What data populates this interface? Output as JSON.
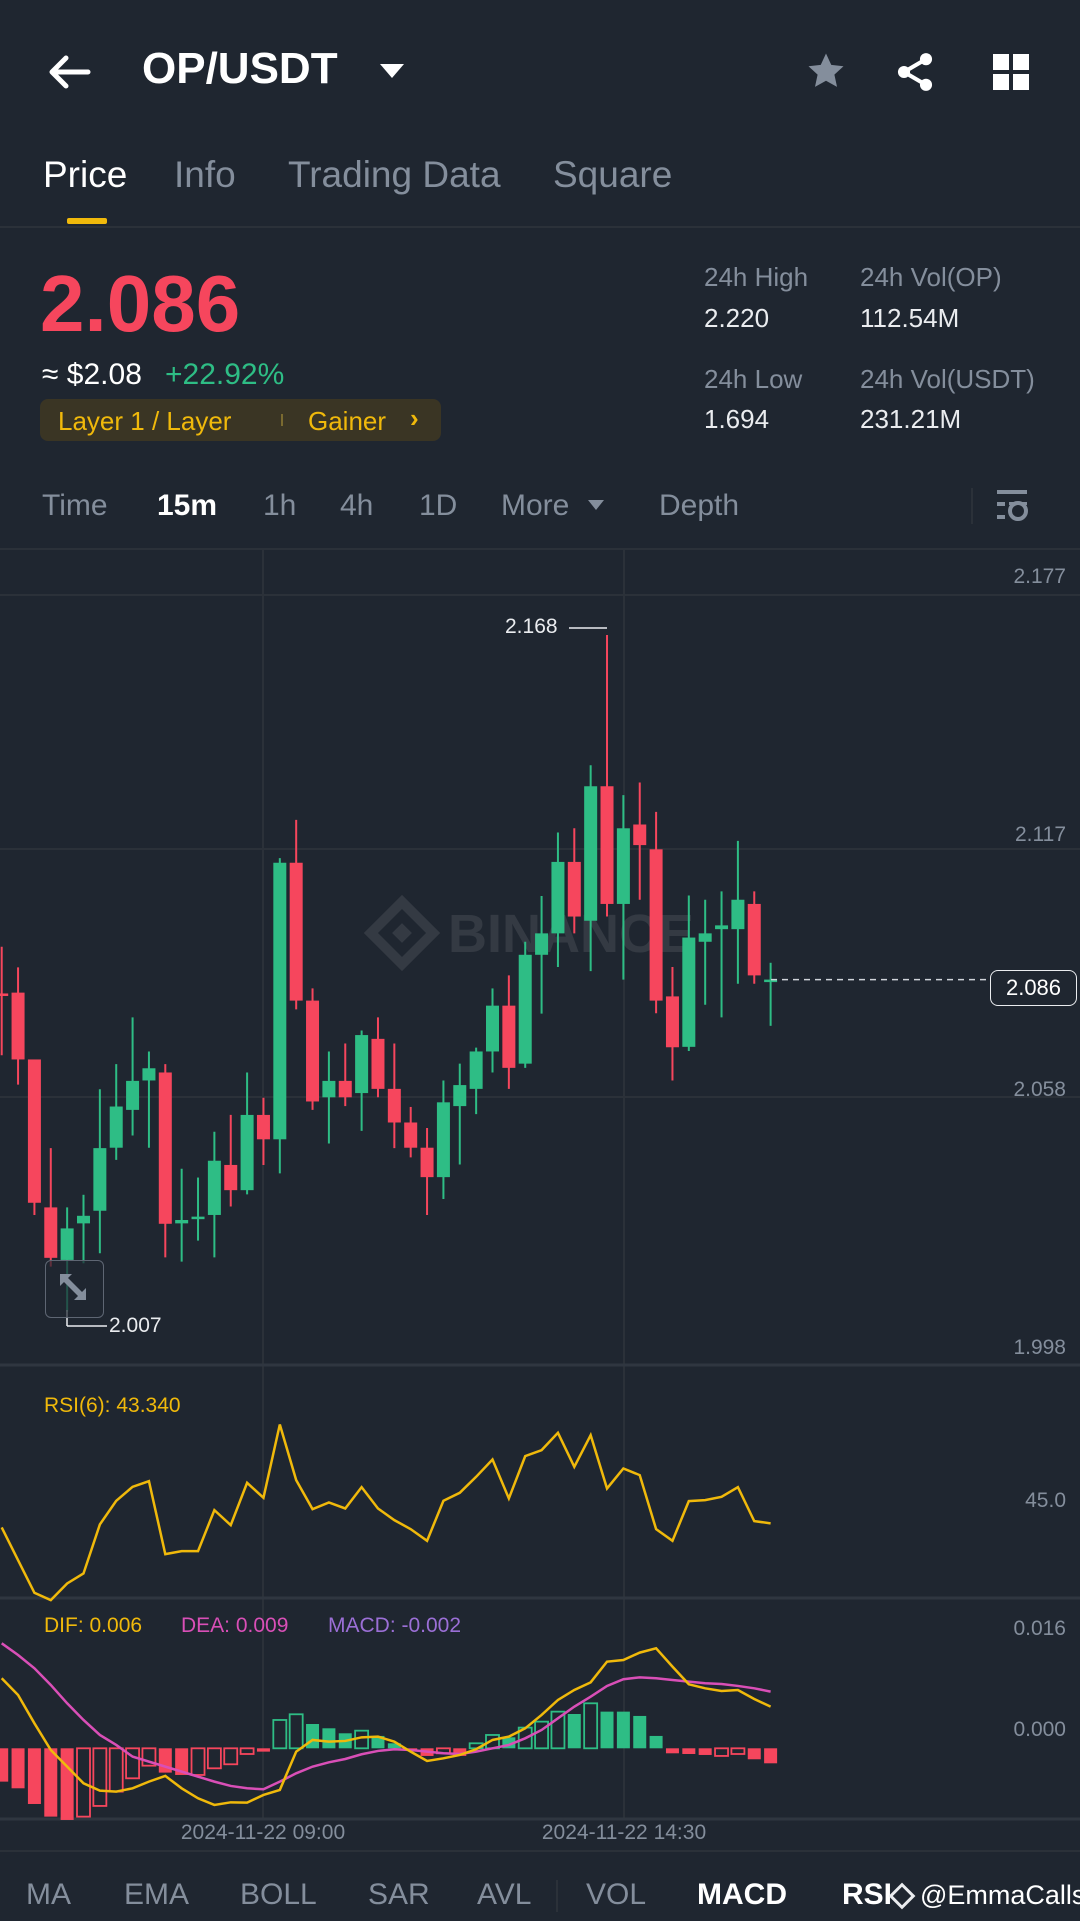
{
  "header": {
    "title": "OP/USDT",
    "icons": [
      "back-arrow-icon",
      "dropdown-caret-icon",
      "star-icon",
      "share-icon",
      "grid-icon"
    ]
  },
  "tabs": [
    {
      "label": "Price",
      "active": true
    },
    {
      "label": "Info"
    },
    {
      "label": "Trading Data"
    },
    {
      "label": "Square"
    }
  ],
  "ticker": {
    "last_price": "2.086",
    "usd_price": "≈ $2.08",
    "change": "+22.92%",
    "tag_category": "Layer 1 / Layer",
    "tag_rank": "Gainer",
    "high_label": "24h High",
    "high": "2.220",
    "low_label": "24h Low",
    "low": "1.694",
    "vol_base_label": "24h Vol(OP)",
    "vol_base": "112.54M",
    "vol_quote_label": "24h Vol(USDT)",
    "vol_quote": "231.21M"
  },
  "intervals": [
    {
      "label": "Time"
    },
    {
      "label": "15m",
      "active": true
    },
    {
      "label": "1h"
    },
    {
      "label": "4h"
    },
    {
      "label": "1D"
    },
    {
      "label": "More"
    },
    {
      "label": "Depth"
    }
  ],
  "chart": {
    "watermark": "BINANCE",
    "price_axis": [
      "2.177",
      "2.117",
      "2.058",
      "1.998"
    ],
    "current_price_tag": "2.086",
    "max_label": "2.168",
    "min_label": "2.007",
    "time_axis": [
      "2024-11-22 09:00",
      "2024-11-22 14:30"
    ],
    "colors": {
      "up": "#2ebd85",
      "down": "#f6465d",
      "dif": "#f0b90b",
      "dea": "#d94fb7",
      "macd": "#9b6fd6",
      "rsi": "#f0b90b"
    }
  },
  "rsi": {
    "label": "RSI(6): 43.340",
    "axis": "45.0"
  },
  "macd": {
    "dif_label": "DIF: 0.006",
    "dea_label": "DEA: 0.009",
    "macd_label": "MACD: -0.002",
    "axis": [
      "0.016",
      "0.000"
    ]
  },
  "indicators": [
    {
      "label": "MA"
    },
    {
      "label": "EMA"
    },
    {
      "label": "BOLL"
    },
    {
      "label": "SAR"
    },
    {
      "label": "AVL"
    },
    {
      "label": "VOL"
    },
    {
      "label": "MACD",
      "active": true
    },
    {
      "label": "RSI"
    }
  ],
  "watermark_user": "@EmmaCalls",
  "chart_data": {
    "type": "candlestick",
    "interval": "15m",
    "ohlc": [
      [
        2.0827,
        2.0938,
        2.068,
        2.0821
      ],
      [
        2.0829,
        2.0889,
        2.061,
        2.067
      ],
      [
        2.067,
        2.067,
        2.03,
        2.0329
      ],
      [
        2.0318,
        2.0459,
        2.0177,
        2.0198
      ],
      [
        2.0193,
        2.0318,
        2.007,
        2.0268
      ],
      [
        2.028,
        2.0348,
        2.0185,
        2.0298
      ],
      [
        2.031,
        2.0599,
        2.0209,
        2.0459
      ],
      [
        2.046,
        2.0659,
        2.0431,
        2.0558
      ],
      [
        2.055,
        2.077,
        2.0489,
        2.0619
      ],
      [
        2.062,
        2.0689,
        2.046,
        2.0649
      ],
      [
        2.0639,
        2.0659,
        2.0199,
        2.0279
      ],
      [
        2.028,
        2.041,
        2.0189,
        2.0288
      ],
      [
        2.029,
        2.0389,
        2.0239,
        2.0296
      ],
      [
        2.03,
        2.0498,
        2.0199,
        2.0429
      ],
      [
        2.0419,
        2.0538,
        2.032,
        2.0359
      ],
      [
        2.0359,
        2.0639,
        2.0349,
        2.0538
      ],
      [
        2.0538,
        2.0579,
        2.0419,
        2.048
      ],
      [
        2.048,
        2.1149,
        2.0399,
        2.1138
      ],
      [
        2.1138,
        2.124,
        2.0789,
        2.081
      ],
      [
        2.081,
        2.0839,
        2.055,
        2.057
      ],
      [
        2.058,
        2.0689,
        2.047,
        2.0619
      ],
      [
        2.0619,
        2.0708,
        2.0559,
        2.058
      ],
      [
        2.059,
        2.0739,
        2.05,
        2.0728
      ],
      [
        2.0719,
        2.077,
        2.058,
        2.06
      ],
      [
        2.06,
        2.0708,
        2.0459,
        2.052
      ],
      [
        2.052,
        2.0557,
        2.0437,
        2.046
      ],
      [
        2.046,
        2.0507,
        2.03,
        2.039
      ],
      [
        2.039,
        2.062,
        2.0338,
        2.0568
      ],
      [
        2.0559,
        2.066,
        2.042,
        2.0609
      ],
      [
        2.06,
        2.0698,
        2.054,
        2.0689
      ],
      [
        2.0689,
        2.0839,
        2.0639,
        2.0798
      ],
      [
        2.0798,
        2.087,
        2.06,
        2.065
      ],
      [
        2.066,
        2.095,
        2.065,
        2.0919
      ],
      [
        2.0919,
        2.1059,
        2.0779,
        2.097
      ],
      [
        2.097,
        2.121,
        2.089,
        2.114
      ],
      [
        2.114,
        2.122,
        2.097,
        2.101
      ],
      [
        2.1,
        2.137,
        2.088,
        2.132
      ],
      [
        2.132,
        2.168,
        2.101,
        2.104
      ],
      [
        2.104,
        2.1299,
        2.086,
        2.122
      ],
      [
        2.1229,
        2.1329,
        2.105,
        2.118
      ],
      [
        2.117,
        2.1259,
        2.078,
        2.081
      ],
      [
        2.082,
        2.089,
        2.062,
        2.0699
      ],
      [
        2.07,
        2.106,
        2.069,
        2.096
      ],
      [
        2.095,
        2.105,
        2.08,
        2.097
      ],
      [
        2.098,
        2.107,
        2.077,
        2.0989
      ],
      [
        2.098,
        2.119,
        2.085,
        2.105
      ],
      [
        2.104,
        2.107,
        2.085,
        2.087
      ],
      [
        2.0858,
        2.09,
        2.075,
        2.086
      ]
    ],
    "ylim": [
      1.998,
      2.177
    ],
    "last_price": 2.086,
    "rsi6": [
      42.1,
      32.3,
      22.5,
      20.3,
      25.3,
      28.3,
      43.0,
      50.1,
      54.3,
      56.0,
      34.1,
      35.0,
      35.0,
      47.3,
      42.8,
      55.5,
      51.0,
      73.0,
      56.3,
      47.6,
      49.6,
      47.8,
      54.2,
      47.8,
      44.3,
      41.6,
      38.1,
      50.1,
      52.5,
      57.3,
      62.5,
      50.8,
      63.5,
      65.3,
      70.5,
      60.3,
      69.8,
      53.8,
      59.8,
      57.8,
      41.6,
      38.1,
      50.0,
      50.3,
      51.3,
      54.2,
      44.0,
      43.34
    ],
    "macd_unit": 0.001,
    "dif": [
      10.08,
      7.68,
      3.6,
      -0.24,
      -2.64,
      -5.04,
      -6.1,
      -6.24,
      -5.76,
      -4.8,
      -3.98,
      -5.76,
      -7.2,
      -8.16,
      -7.78,
      -7.82,
      -6.72,
      -6.0,
      -0.48,
      1.2,
      0.96,
      1.06,
      1.58,
      1.68,
      0.96,
      -0.48,
      -1.82,
      -1.44,
      -0.96,
      -0.14,
      1.2,
      1.68,
      2.88,
      4.8,
      6.96,
      8.4,
      9.5,
      12.48,
      12.72,
      13.78,
      14.4,
      11.76,
      9.22,
      8.64,
      8.26,
      8.4,
      7.1,
      6.0
    ],
    "dea": [
      15.12,
      13.44,
      11.52,
      9.12,
      6.48,
      4.08,
      1.92,
      0.48,
      -1.2,
      -1.92,
      -2.64,
      -3.36,
      -4.08,
      -4.8,
      -5.42,
      -5.76,
      -5.9,
      -4.8,
      -3.6,
      -2.64,
      -2.02,
      -1.54,
      -0.86,
      -0.38,
      -0.14,
      -0.24,
      -0.48,
      -0.72,
      -0.82,
      -0.48,
      0,
      0.48,
      1.44,
      2.64,
      4.32,
      6.0,
      7.44,
      8.98,
      9.94,
      10.22,
      10.08,
      9.84,
      9.6,
      9.36,
      9.26,
      8.98,
      8.64,
      8.16
    ],
    "macd_hist": [
      -4.8,
      -5.76,
      -8.02,
      -9.84,
      -10.32,
      -9.84,
      -8.3,
      -6.24,
      -4.32,
      -2.5,
      -3.5,
      -3.84,
      -3.84,
      -2.88,
      -2.3,
      -0.82,
      -0.48,
      4.08,
      4.9,
      3.5,
      2.88,
      2.16,
      2.54,
      1.78,
      0.72,
      -0.34,
      -1.1,
      -0.72,
      -1.1,
      0.72,
      1.92,
      1.58,
      2.98,
      3.84,
      5.28,
      4.94,
      6.48,
      5.28,
      5.28,
      4.66,
      1.78,
      -0.72,
      -0.82,
      -0.96,
      -1.1,
      -0.82,
      -1.58,
      -2.16
    ],
    "macd_hist_hollow": [
      0,
      0,
      0,
      0,
      0,
      1,
      1,
      1,
      1,
      1,
      0,
      0,
      1,
      1,
      1,
      1,
      0,
      1,
      1,
      0,
      0,
      0,
      1,
      0,
      0,
      0,
      0,
      1,
      0,
      1,
      1,
      0,
      1,
      1,
      1,
      0,
      1,
      0,
      0,
      0,
      0,
      0,
      0,
      0,
      1,
      1,
      0,
      0
    ]
  }
}
